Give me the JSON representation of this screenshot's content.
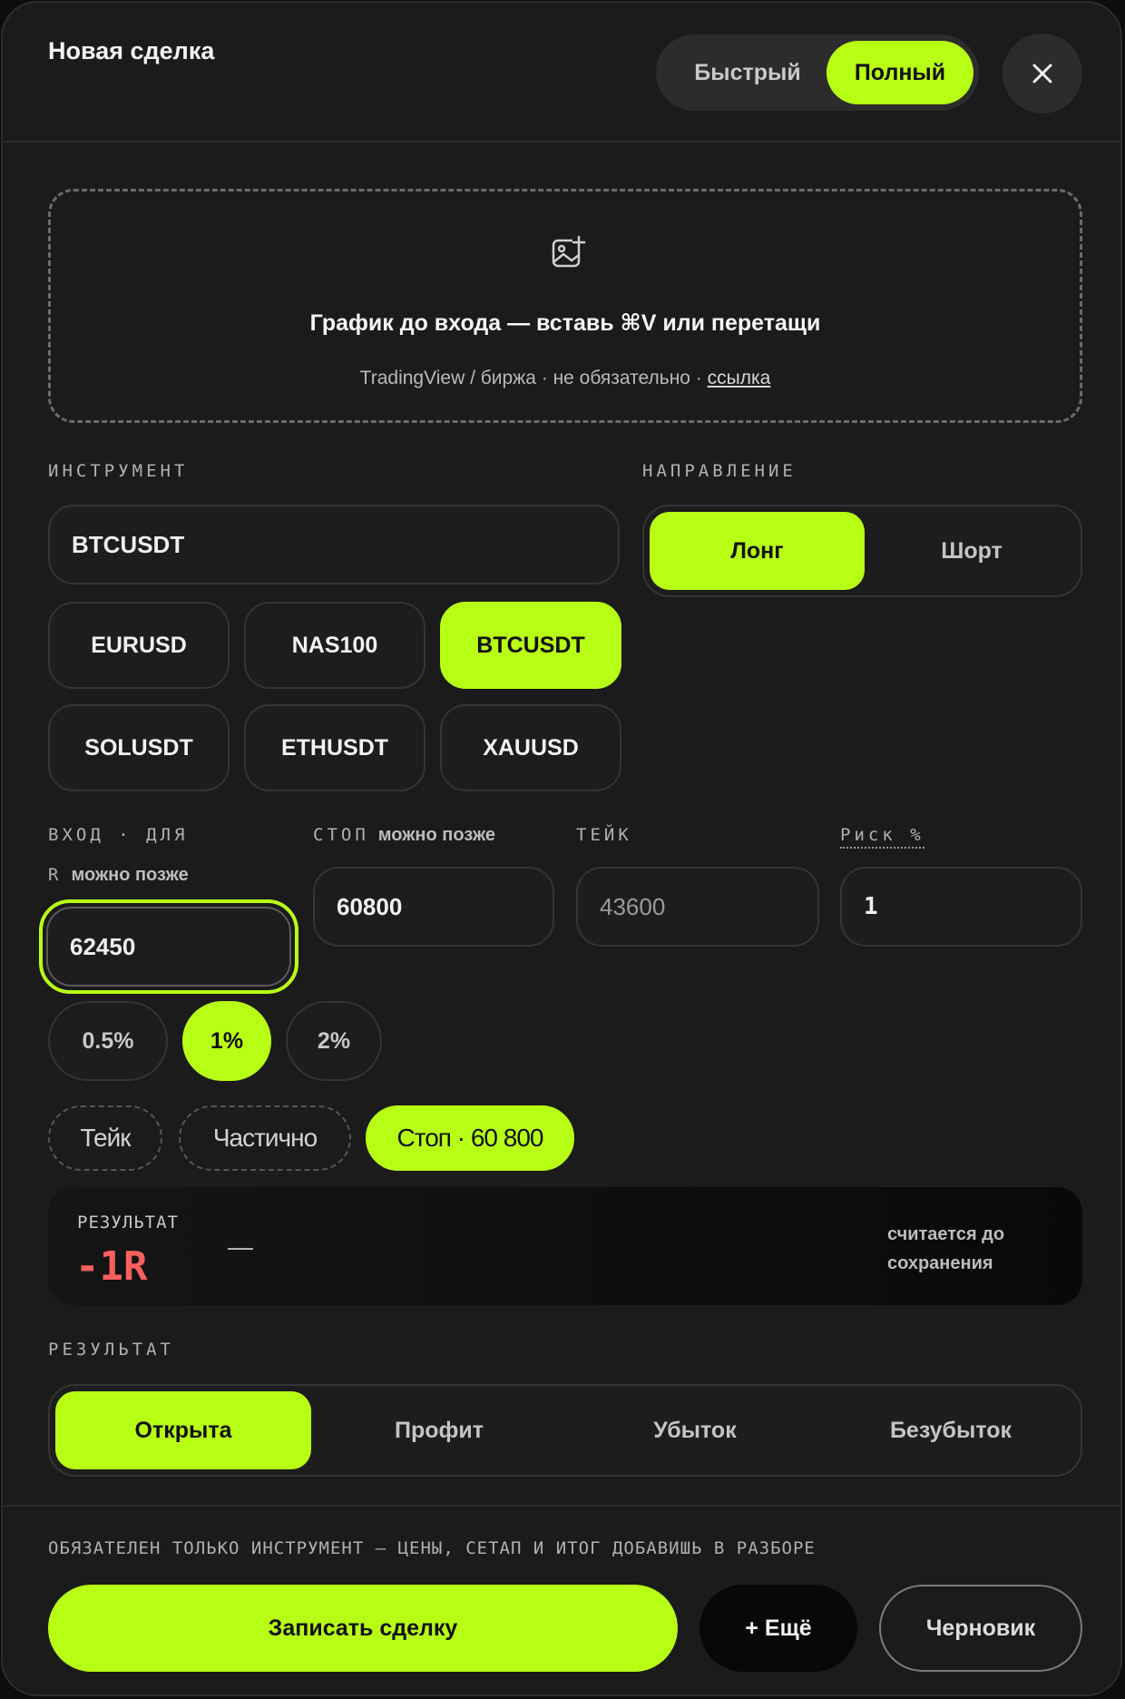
{
  "header": {
    "title": "Новая сделка",
    "mode_quick": "Быстрый",
    "mode_full": "Полный",
    "close_icon": "close-icon"
  },
  "dropzone": {
    "icon": "image-add-icon",
    "title": "График до входа — вставь ⌘V или перетащи",
    "subtitle": "TradingView / биржа · не обязательно · ",
    "link": "ссылка"
  },
  "instrument": {
    "label": "ИНСТРУМЕНТ",
    "value": "BTCUSDT",
    "chips": [
      "EURUSD",
      "NAS100",
      "BTCUSDT",
      "SOLUSDT",
      "ETHUSDT",
      "XAUUSD"
    ],
    "selected": "BTCUSDT"
  },
  "direction": {
    "label": "НАПРАВЛЕНИЕ",
    "long": "Лонг",
    "short": "Шорт",
    "selected": "Лонг"
  },
  "prices": {
    "entry_label": "ВХОД · ДЛЯ",
    "entry_label_line2": "R",
    "entry_hint": "можно позже",
    "entry_value": "62450",
    "stop_label": "СТОП",
    "stop_hint": "можно позже",
    "stop_value": "60800",
    "take_label": "ТЕЙК",
    "take_value": "43600",
    "risk_label": "Риск %",
    "risk_value": "1"
  },
  "risk_presets": [
    "0.5%",
    "1%",
    "2%"
  ],
  "risk_selected": "1%",
  "outcome_options": [
    "Тейк",
    "Частично",
    "Стоп · 60 800"
  ],
  "outcome_selected": "Стоп · 60 800",
  "result_card": {
    "label": "РЕЗУЛЬТАТ",
    "value": "-1R",
    "dash": "—",
    "note": "считается до сохранения"
  },
  "status": {
    "label": "РЕЗУЛЬТАТ",
    "options": [
      "Открыта",
      "Профит",
      "Убыток",
      "Безубыток"
    ],
    "selected": "Открыта"
  },
  "footer": {
    "note": "ОБЯЗАТЕЛЕН ТОЛЬКО ИНСТРУМЕНТ — ЦЕНЫ, СЕТАП И ИТОГ ДОБАВИШЬ В РАЗБОРЕ",
    "save": "Записать сделку",
    "more": "+ Ещё",
    "draft": "Черновик"
  },
  "colors": {
    "accent": "#b8ff16",
    "negative": "#ff5f5f",
    "background": "#1a1b1a"
  }
}
